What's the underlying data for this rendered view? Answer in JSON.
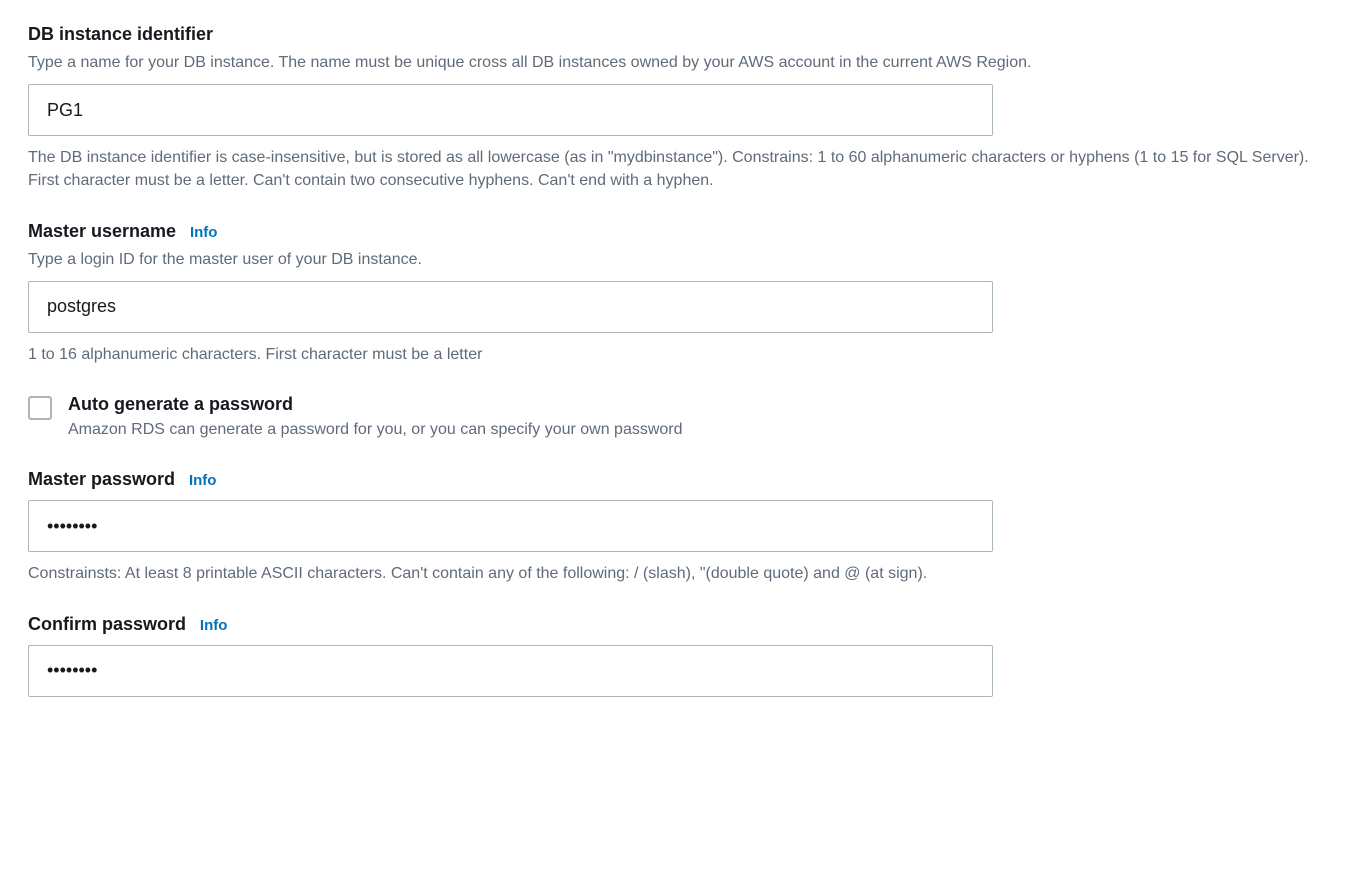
{
  "db_identifier": {
    "label": "DB instance identifier",
    "description": "Type a name for your DB instance. The name must be unique cross all DB instances owned by your AWS account in the current AWS Region.",
    "value": "PG1",
    "help": "The DB instance identifier is case-insensitive, but is stored as all lowercase (as in \"mydbinstance\"). Constrains: 1 to 60 alphanumeric characters or hyphens (1 to 15 for SQL Server). First character must be a letter. Can't contain two consecutive hyphens. Can't end with a hyphen."
  },
  "master_username": {
    "label": "Master username",
    "info": "Info",
    "description": "Type a login ID for the master user of your DB instance.",
    "value": "postgres",
    "help": "1 to 16 alphanumeric characters. First character must be a letter"
  },
  "auto_generate": {
    "label": "Auto generate a password",
    "description": "Amazon RDS can generate a password for you, or you can specify your own password"
  },
  "master_password": {
    "label": "Master password",
    "info": "Info",
    "value": "••••••••",
    "help": "Constrainsts: At least 8 printable ASCII characters. Can't contain any of the following: / (slash), \"(double quote) and @ (at sign)."
  },
  "confirm_password": {
    "label": "Confirm password",
    "info": "Info",
    "value": "••••••••"
  }
}
